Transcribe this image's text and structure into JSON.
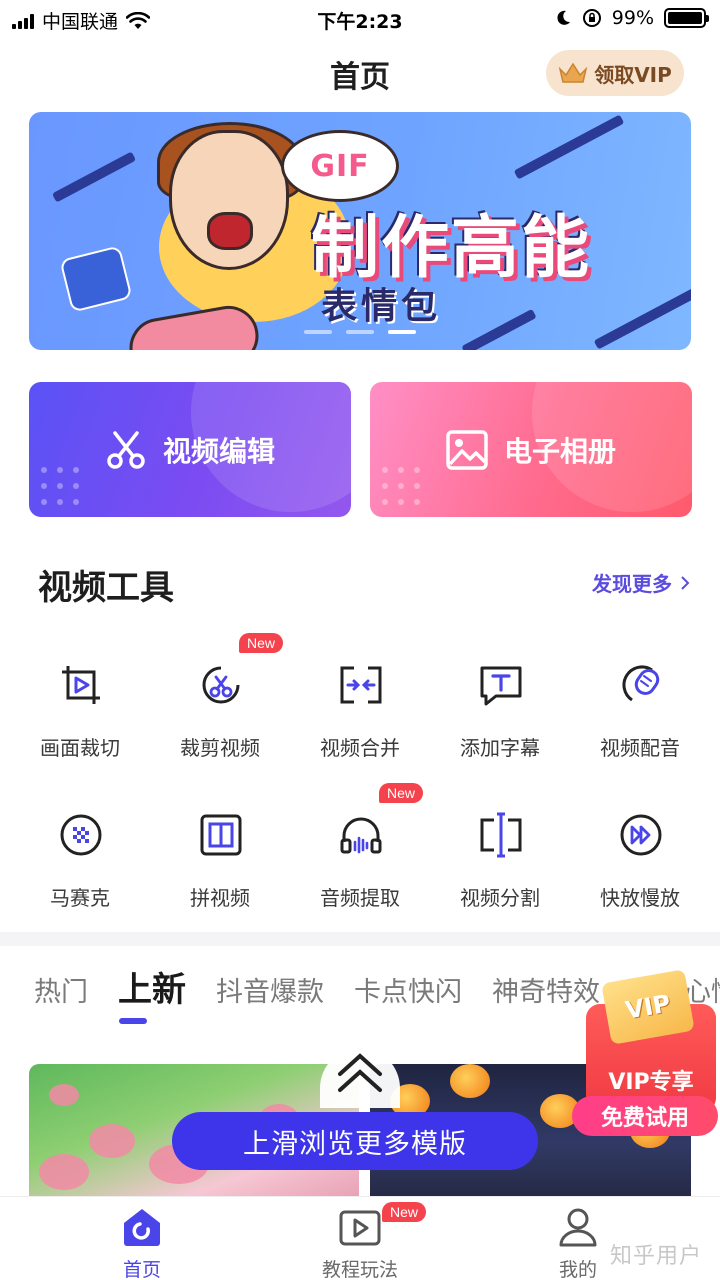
{
  "status_bar": {
    "carrier": "中国联通",
    "time": "下午2:23",
    "battery": "99%"
  },
  "header": {
    "title": "首页",
    "vip_button": "领取VIP"
  },
  "banner": {
    "badge": "GIF",
    "headline": "制作高能",
    "subline": "表情包",
    "slide_count": 3,
    "active_slide": 3
  },
  "features": [
    {
      "label": "视频编辑",
      "icon": "scissors-icon"
    },
    {
      "label": "电子相册",
      "icon": "image-icon"
    }
  ],
  "section": {
    "title": "视频工具",
    "more": "发现更多"
  },
  "tools": [
    {
      "label": "画面裁切",
      "icon": "crop-icon",
      "badge": ""
    },
    {
      "label": "裁剪视频",
      "icon": "scissors-circle-icon",
      "badge": "New"
    },
    {
      "label": "视频合并",
      "icon": "merge-icon",
      "badge": ""
    },
    {
      "label": "添加字幕",
      "icon": "subtitle-icon",
      "badge": ""
    },
    {
      "label": "视频配音",
      "icon": "microphone-icon",
      "badge": ""
    },
    {
      "label": "马赛克",
      "icon": "mosaic-icon",
      "badge": ""
    },
    {
      "label": "拼视频",
      "icon": "split-screen-icon",
      "badge": ""
    },
    {
      "label": "音频提取",
      "icon": "headphones-icon",
      "badge": "New"
    },
    {
      "label": "视频分割",
      "icon": "split-icon",
      "badge": ""
    },
    {
      "label": "快放慢放",
      "icon": "fast-forward-icon",
      "badge": ""
    }
  ],
  "category_tabs": [
    "热门",
    "上新",
    "抖音爆款",
    "卡点快闪",
    "神奇特效",
    "亲爱心情"
  ],
  "active_tab": "上新",
  "browse_more": "上滑浏览更多模版",
  "vip_promo": {
    "card": "VIP",
    "title": "VIP专享",
    "cta": "免费试用"
  },
  "bottom_nav": [
    {
      "label": "首页",
      "icon": "home-icon",
      "active": true,
      "badge": ""
    },
    {
      "label": "教程玩法",
      "icon": "video-tutorial-icon",
      "active": false,
      "badge": "New"
    },
    {
      "label": "我的",
      "icon": "profile-icon",
      "active": false,
      "badge": ""
    }
  ],
  "watermark": "知乎用户",
  "colors": {
    "accent": "#4a45e8",
    "badge_red": "#f4434d",
    "vip_gold": "#f8e3cf"
  }
}
